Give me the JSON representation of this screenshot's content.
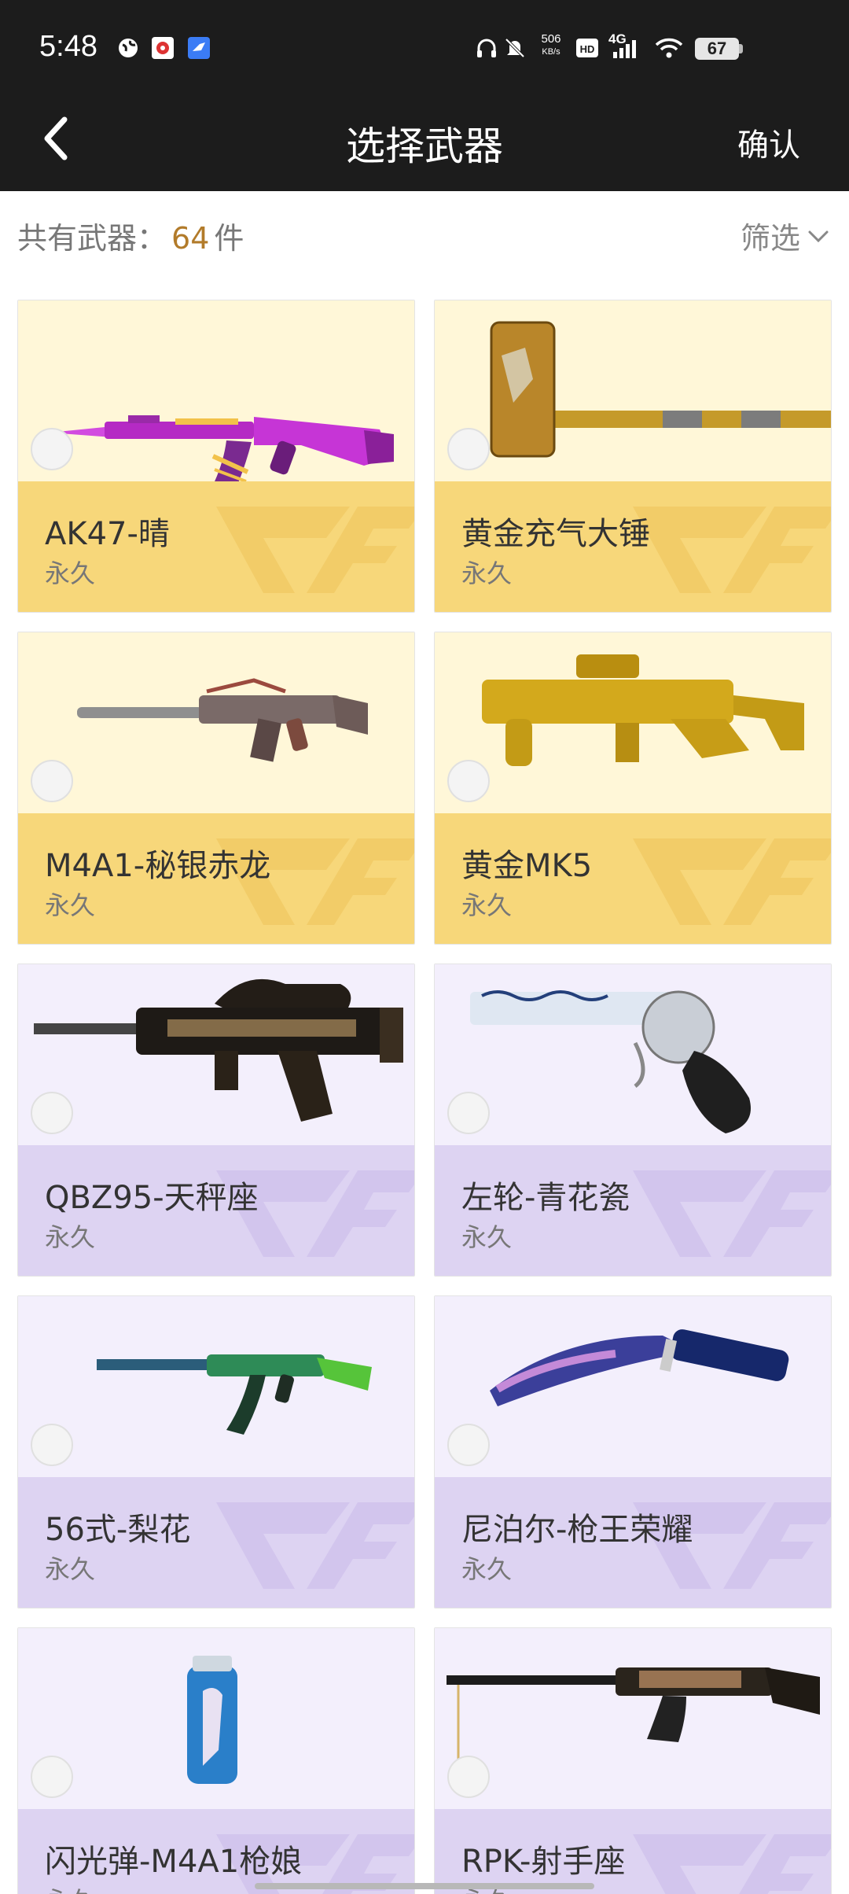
{
  "status_bar": {
    "time": "5:48",
    "net_speed_value": "506",
    "net_speed_unit": "KB/s",
    "network": "4G",
    "battery": "67",
    "icons": [
      "globe-icon",
      "app-badge-icon",
      "feishu-icon",
      "headphones-icon",
      "mute-icon",
      "hd-icon",
      "signal-icon",
      "wifi-icon"
    ]
  },
  "nav": {
    "title": "选择武器",
    "confirm_label": "确认",
    "back_icon": "chevron-left-icon"
  },
  "summary": {
    "prefix": "共有武器：",
    "count": "64",
    "unit": "件",
    "filter_label": "筛选",
    "filter_icon": "chevron-down-icon"
  },
  "colors": {
    "gold_top": "#fff7d8",
    "gold_bottom": "#f7d77a",
    "purple_top": "#f3effc",
    "purple_bottom": "#ddd3f2",
    "count_accent": "#b27b2a",
    "header_bg": "#1c1c1c"
  },
  "weapons": [
    {
      "name": "AK47-晴",
      "duration": "永久",
      "rarity": "gold",
      "image": "ak47-rifle-pink"
    },
    {
      "name": "黄金充气大锤",
      "duration": "永久",
      "rarity": "gold",
      "image": "golden-hammer"
    },
    {
      "name": "M4A1-秘银赤龙",
      "duration": "永久",
      "rarity": "gold",
      "image": "m4a1-rifle-silver"
    },
    {
      "name": "黄金MK5",
      "duration": "永久",
      "rarity": "gold",
      "image": "golden-smg"
    },
    {
      "name": "QBZ95-天秤座",
      "duration": "永久",
      "rarity": "purple",
      "image": "qbz95-rifle-black-gold"
    },
    {
      "name": "左轮-青花瓷",
      "duration": "永久",
      "rarity": "purple",
      "image": "revolver-blue-porcelain"
    },
    {
      "name": "56式-梨花",
      "duration": "永久",
      "rarity": "purple",
      "image": "type56-rifle-green"
    },
    {
      "name": "尼泊尔-枪王荣耀",
      "duration": "永久",
      "rarity": "purple",
      "image": "kukri-knife-blue"
    },
    {
      "name": "闪光弹-M4A1枪娘",
      "duration": "永久",
      "rarity": "purple",
      "image": "flash-grenade-blue"
    },
    {
      "name": "RPK-射手座",
      "duration": "永久",
      "rarity": "purple",
      "image": "rpk-machinegun-black-gold"
    }
  ]
}
